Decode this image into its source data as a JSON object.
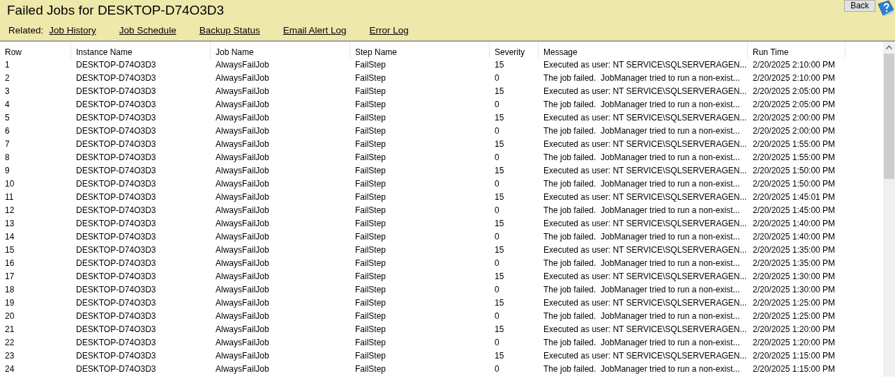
{
  "title": "Failed Jobs for DESKTOP-D74O3D3",
  "back_button": "Back",
  "related": {
    "label": "Related:",
    "links": [
      "Job History",
      "Job Schedule",
      "Backup Status",
      "Email Alert Log",
      "Error Log"
    ]
  },
  "table": {
    "columns": [
      "Row",
      "Instance Name",
      "Job Name",
      "Step Name",
      "Severity",
      "Message",
      "Run Time"
    ],
    "rows": [
      [
        "1",
        "DESKTOP-D74O3D3",
        "AlwaysFailJob",
        "FailStep",
        "15",
        "Executed as user: NT SERVICE\\SQLSERVERAGEN...",
        "2/20/2025 2:10:00 PM"
      ],
      [
        "2",
        "DESKTOP-D74O3D3",
        "AlwaysFailJob",
        "FailStep",
        "0",
        "The job failed.  JobManager tried to run a non-exist...",
        "2/20/2025 2:10:00 PM"
      ],
      [
        "3",
        "DESKTOP-D74O3D3",
        "AlwaysFailJob",
        "FailStep",
        "15",
        "Executed as user: NT SERVICE\\SQLSERVERAGEN...",
        "2/20/2025 2:05:00 PM"
      ],
      [
        "4",
        "DESKTOP-D74O3D3",
        "AlwaysFailJob",
        "FailStep",
        "0",
        "The job failed.  JobManager tried to run a non-exist...",
        "2/20/2025 2:05:00 PM"
      ],
      [
        "5",
        "DESKTOP-D74O3D3",
        "AlwaysFailJob",
        "FailStep",
        "15",
        "Executed as user: NT SERVICE\\SQLSERVERAGEN...",
        "2/20/2025 2:00:00 PM"
      ],
      [
        "6",
        "DESKTOP-D74O3D3",
        "AlwaysFailJob",
        "FailStep",
        "0",
        "The job failed.  JobManager tried to run a non-exist...",
        "2/20/2025 2:00:00 PM"
      ],
      [
        "7",
        "DESKTOP-D74O3D3",
        "AlwaysFailJob",
        "FailStep",
        "15",
        "Executed as user: NT SERVICE\\SQLSERVERAGEN...",
        "2/20/2025 1:55:00 PM"
      ],
      [
        "8",
        "DESKTOP-D74O3D3",
        "AlwaysFailJob",
        "FailStep",
        "0",
        "The job failed.  JobManager tried to run a non-exist...",
        "2/20/2025 1:55:00 PM"
      ],
      [
        "9",
        "DESKTOP-D74O3D3",
        "AlwaysFailJob",
        "FailStep",
        "15",
        "Executed as user: NT SERVICE\\SQLSERVERAGEN...",
        "2/20/2025 1:50:00 PM"
      ],
      [
        "10",
        "DESKTOP-D74O3D3",
        "AlwaysFailJob",
        "FailStep",
        "0",
        "The job failed.  JobManager tried to run a non-exist...",
        "2/20/2025 1:50:00 PM"
      ],
      [
        "11",
        "DESKTOP-D74O3D3",
        "AlwaysFailJob",
        "FailStep",
        "15",
        "Executed as user: NT SERVICE\\SQLSERVERAGEN...",
        "2/20/2025 1:45:01 PM"
      ],
      [
        "12",
        "DESKTOP-D74O3D3",
        "AlwaysFailJob",
        "FailStep",
        "0",
        "The job failed.  JobManager tried to run a non-exist...",
        "2/20/2025 1:45:00 PM"
      ],
      [
        "13",
        "DESKTOP-D74O3D3",
        "AlwaysFailJob",
        "FailStep",
        "15",
        "Executed as user: NT SERVICE\\SQLSERVERAGEN...",
        "2/20/2025 1:40:00 PM"
      ],
      [
        "14",
        "DESKTOP-D74O3D3",
        "AlwaysFailJob",
        "FailStep",
        "0",
        "The job failed.  JobManager tried to run a non-exist...",
        "2/20/2025 1:40:00 PM"
      ],
      [
        "15",
        "DESKTOP-D74O3D3",
        "AlwaysFailJob",
        "FailStep",
        "15",
        "Executed as user: NT SERVICE\\SQLSERVERAGEN...",
        "2/20/2025 1:35:00 PM"
      ],
      [
        "16",
        "DESKTOP-D74O3D3",
        "AlwaysFailJob",
        "FailStep",
        "0",
        "The job failed.  JobManager tried to run a non-exist...",
        "2/20/2025 1:35:00 PM"
      ],
      [
        "17",
        "DESKTOP-D74O3D3",
        "AlwaysFailJob",
        "FailStep",
        "15",
        "Executed as user: NT SERVICE\\SQLSERVERAGEN...",
        "2/20/2025 1:30:00 PM"
      ],
      [
        "18",
        "DESKTOP-D74O3D3",
        "AlwaysFailJob",
        "FailStep",
        "0",
        "The job failed.  JobManager tried to run a non-exist...",
        "2/20/2025 1:30:00 PM"
      ],
      [
        "19",
        "DESKTOP-D74O3D3",
        "AlwaysFailJob",
        "FailStep",
        "15",
        "Executed as user: NT SERVICE\\SQLSERVERAGEN...",
        "2/20/2025 1:25:00 PM"
      ],
      [
        "20",
        "DESKTOP-D74O3D3",
        "AlwaysFailJob",
        "FailStep",
        "0",
        "The job failed.  JobManager tried to run a non-exist...",
        "2/20/2025 1:25:00 PM"
      ],
      [
        "21",
        "DESKTOP-D74O3D3",
        "AlwaysFailJob",
        "FailStep",
        "15",
        "Executed as user: NT SERVICE\\SQLSERVERAGEN...",
        "2/20/2025 1:20:00 PM"
      ],
      [
        "22",
        "DESKTOP-D74O3D3",
        "AlwaysFailJob",
        "FailStep",
        "0",
        "The job failed.  JobManager tried to run a non-exist...",
        "2/20/2025 1:20:00 PM"
      ],
      [
        "23",
        "DESKTOP-D74O3D3",
        "AlwaysFailJob",
        "FailStep",
        "15",
        "Executed as user: NT SERVICE\\SQLSERVERAGEN...",
        "2/20/2025 1:15:00 PM"
      ],
      [
        "24",
        "DESKTOP-D74O3D3",
        "AlwaysFailJob",
        "FailStep",
        "0",
        "The job failed.  JobManager tried to run a non-exist...",
        "2/20/2025 1:15:00 PM"
      ]
    ]
  }
}
